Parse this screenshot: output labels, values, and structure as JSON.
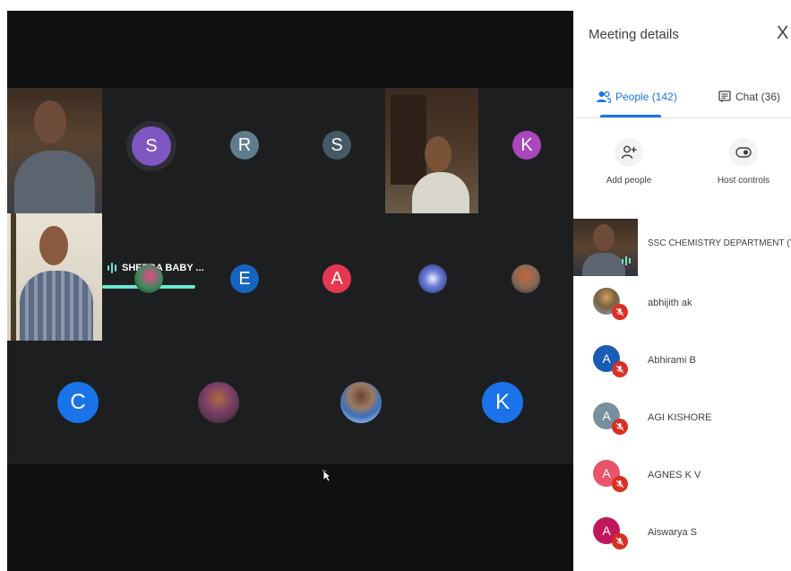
{
  "speaking": {
    "name": "SHEEBA BABY ..."
  },
  "grid": {
    "tiles": [
      {
        "initial": "S",
        "color": "#7e57c2"
      },
      {
        "initial": "R",
        "color": "#607d8b"
      },
      {
        "initial": "S",
        "color": "#455a64"
      },
      {
        "initial": "K",
        "color": "#ab47bc"
      },
      {
        "initial": "E",
        "color": "#1565c0"
      },
      {
        "initial": "A",
        "color": "#e53950"
      },
      {
        "initial": "C",
        "color": "#1a73e8"
      },
      {
        "initial": "K",
        "color": "#1a73e8"
      }
    ]
  },
  "panel": {
    "title": "Meeting details",
    "close_label": "X",
    "tabs": {
      "people_label": "People (142)",
      "chat_label": "Chat (36)"
    },
    "actions": {
      "add_people_label": "Add people",
      "host_controls_label": "Host controls"
    },
    "people": [
      {
        "name": "SSC CHEMISTRY DEPARTMENT (You)",
        "initial": "",
        "color": "#5d4037"
      },
      {
        "name": "abhijith ak",
        "initial": "",
        "color": "#8d6e63"
      },
      {
        "name": "Abhirami B",
        "initial": "A",
        "color": "#1a5bb5"
      },
      {
        "name": "AGI KISHORE",
        "initial": "A",
        "color": "#78909c"
      },
      {
        "name": "AGNES K V",
        "initial": "A",
        "color": "#e8556b"
      },
      {
        "name": "Aiswarya S",
        "initial": "A",
        "color": "#c2185b"
      }
    ]
  },
  "colors": {
    "accent": "#1a73e8",
    "speaking": "#6ee7d0",
    "mute": "#d93025",
    "grid_bg": "#1d1e20"
  }
}
